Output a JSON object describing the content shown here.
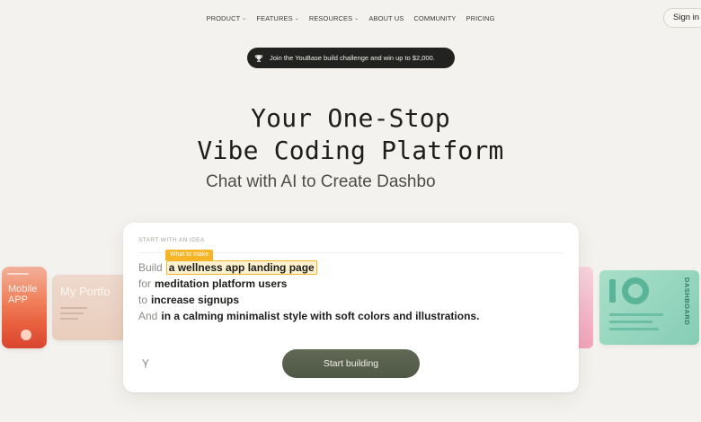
{
  "nav": {
    "items": [
      {
        "label": "PRODUCT",
        "dropdown": true
      },
      {
        "label": "FEATURES",
        "dropdown": true
      },
      {
        "label": "RESOURCES",
        "dropdown": true
      },
      {
        "label": "ABOUT US",
        "dropdown": false
      },
      {
        "label": "COMMUNITY",
        "dropdown": false
      },
      {
        "label": "PRICING",
        "dropdown": false
      }
    ],
    "caret": "⌄",
    "signin_label": "Sign in"
  },
  "banner": {
    "icon": "trophy-icon",
    "text": "Join the YouBase build challenge and win up to $2,000."
  },
  "hero": {
    "title_line1": "Your One-Stop",
    "title_line2": "Vibe Coding Platform",
    "subtitle": "Chat with AI to Create Dashbo"
  },
  "side_cards": {
    "mobile_text": "Mobile APP",
    "portfolio_text": "My Portfo",
    "dashboard_text": "DASHBOARD"
  },
  "prompt": {
    "section_label": "START WITH AN IDEA",
    "tooltip": "What to make",
    "lines": [
      {
        "keyword": "Build",
        "value": "a wellness app landing page"
      },
      {
        "keyword": "for",
        "value": "meditation platform users"
      },
      {
        "keyword": "to",
        "value": "increase signups"
      },
      {
        "keyword": "And",
        "value": "in a calming minimalist style with soft colors and illustrations."
      }
    ],
    "tool_icon": "wand-icon",
    "start_button": "Start building"
  },
  "colors": {
    "page_bg": "#f4f2ee",
    "highlight": "#f6b427",
    "button": "#555d4b"
  }
}
